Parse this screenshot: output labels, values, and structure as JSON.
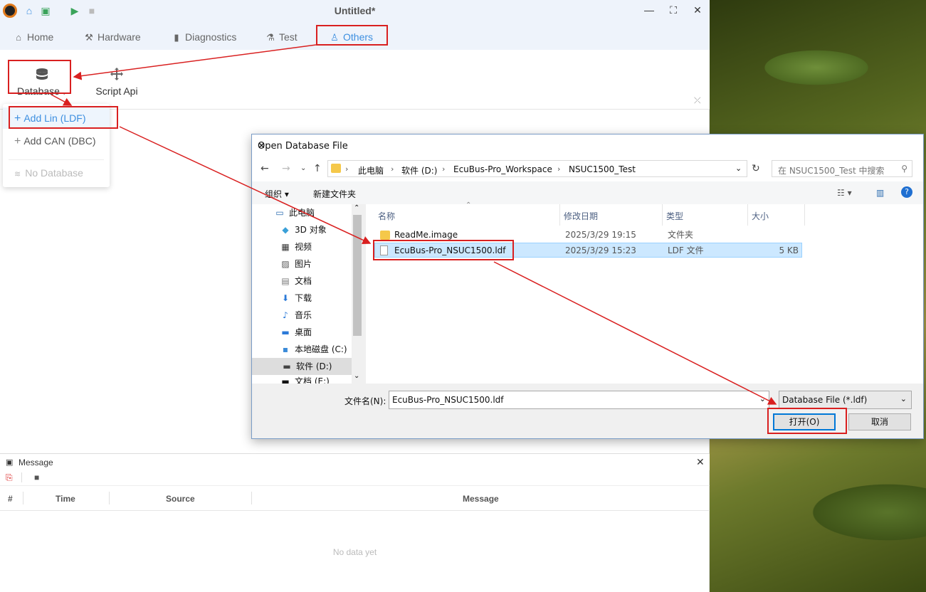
{
  "app": {
    "title": "Untitled*",
    "window_controls": [
      "—",
      "⛶",
      "✕"
    ]
  },
  "tabs": [
    {
      "label": "Home",
      "icon": "home-icon"
    },
    {
      "label": "Hardware",
      "icon": "hammer-icon"
    },
    {
      "label": "Diagnostics",
      "icon": "diagnostics-icon"
    },
    {
      "label": "Test",
      "icon": "flask-icon"
    },
    {
      "label": "Others",
      "icon": "user-icon",
      "active": true
    }
  ],
  "ribbon": {
    "database_label": "Database",
    "script_api_label": "Script Api"
  },
  "dropdown": {
    "items": [
      {
        "label": "Add Lin (LDF)",
        "selected": true
      },
      {
        "label": "Add CAN (DBC)"
      },
      {
        "label": "No Database",
        "disabled": true
      }
    ]
  },
  "message_panel": {
    "title": "Message",
    "columns": [
      "#",
      "Time",
      "Source",
      "Message"
    ],
    "empty_text": "No data yet"
  },
  "dialog": {
    "title": "Open Database File",
    "breadcrumbs": [
      "此电脑",
      "软件 (D:)",
      "EcuBus-Pro_Workspace",
      "NSUC1500_Test"
    ],
    "search_placeholder": "在 NSUC1500_Test 中搜索",
    "toolbar": {
      "organize": "组织 ▾",
      "new_folder": "新建文件夹"
    },
    "nav_items": [
      {
        "label": "此电脑",
        "icon": "computer-icon"
      },
      {
        "label": "3D 对象",
        "icon": "cube-icon"
      },
      {
        "label": "视频",
        "icon": "video-icon"
      },
      {
        "label": "图片",
        "icon": "picture-icon"
      },
      {
        "label": "文档",
        "icon": "document-icon"
      },
      {
        "label": "下载",
        "icon": "download-icon"
      },
      {
        "label": "音乐",
        "icon": "music-icon"
      },
      {
        "label": "桌面",
        "icon": "desktop-icon"
      },
      {
        "label": "本地磁盘 (C:)",
        "icon": "drive-icon"
      },
      {
        "label": "软件 (D:)",
        "icon": "drive-icon",
        "selected": true
      },
      {
        "label": "文档 (E:)",
        "icon": "drive-icon"
      }
    ],
    "columns": [
      "名称",
      "修改日期",
      "类型",
      "大小"
    ],
    "files": [
      {
        "name": "ReadMe.image",
        "date": "2025/3/29 19:15",
        "type": "文件夹",
        "size": "",
        "kind": "folder"
      },
      {
        "name": "EcuBus-Pro_NSUC1500.ldf",
        "date": "2025/3/29 15:23",
        "type": "LDF 文件",
        "size": "5 KB",
        "kind": "file",
        "selected": true
      }
    ],
    "filename_label": "文件名(N):",
    "filename_value": "EcuBus-Pro_NSUC1500.ldf",
    "filetype_value": "Database File (*.ldf)",
    "open_label": "打开(O)",
    "cancel_label": "取消"
  },
  "colors": {
    "accent": "#3d8fe0",
    "annotation": "#d92020"
  }
}
